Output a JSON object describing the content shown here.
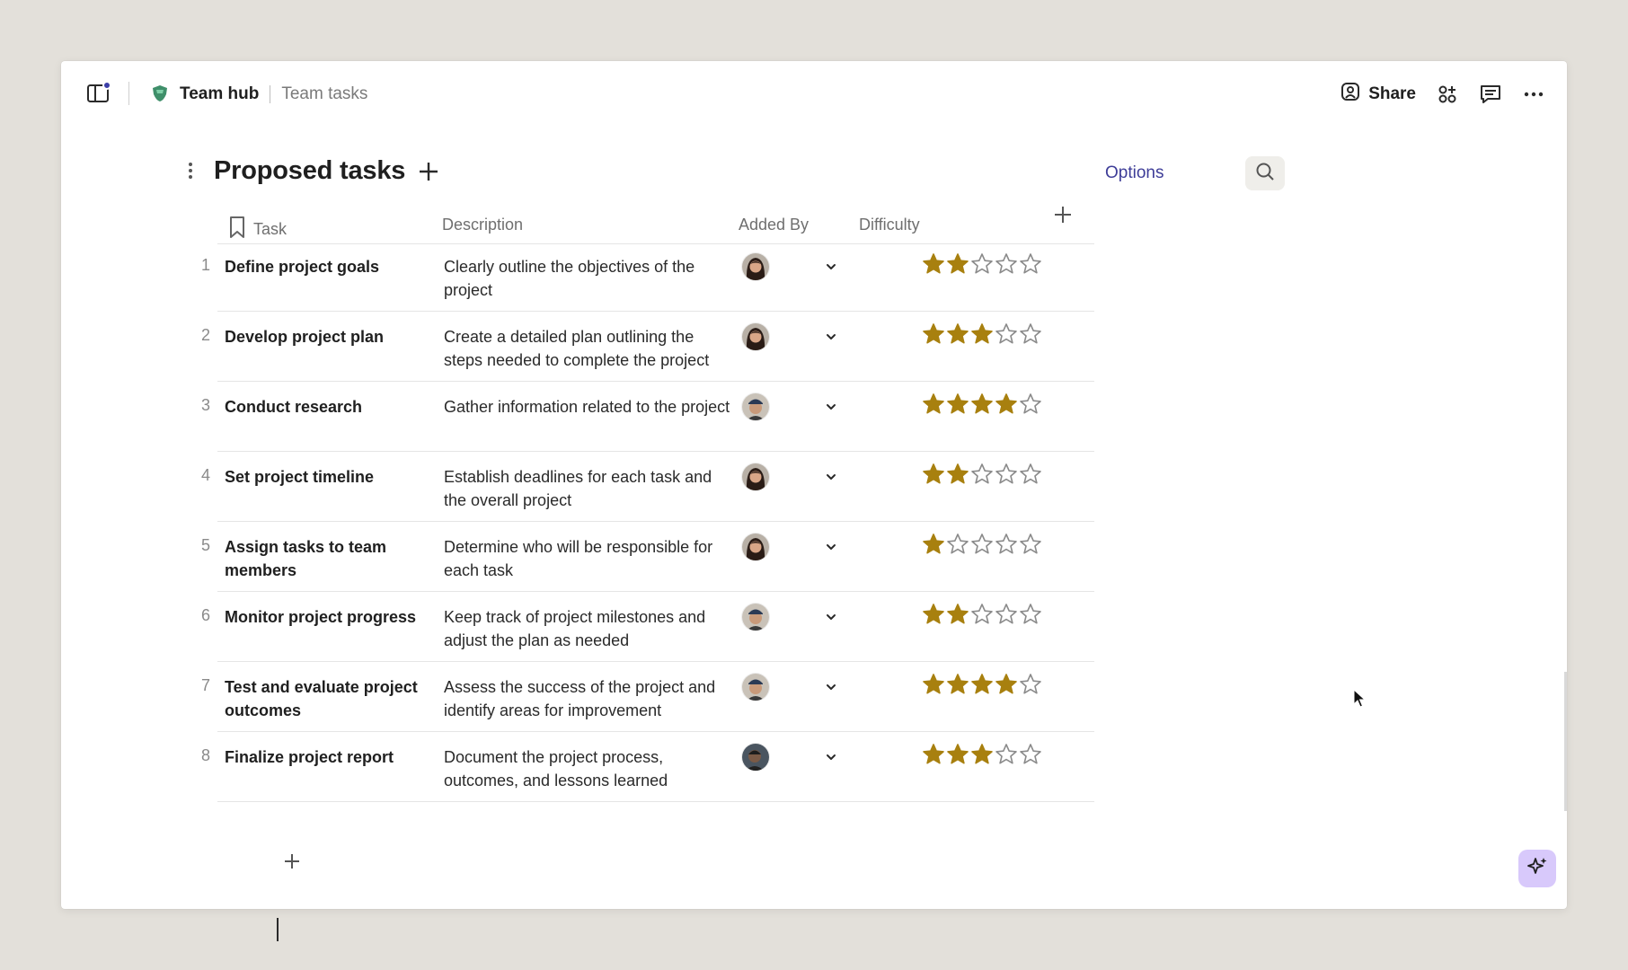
{
  "header": {
    "doc_title": "Team hub",
    "page_title": "Team tasks",
    "share_label": "Share"
  },
  "table": {
    "title": "Proposed tasks",
    "options_label": "Options",
    "columns": {
      "task": "Task",
      "description": "Description",
      "added_by": "Added By",
      "difficulty": "Difficulty"
    },
    "rows": [
      {
        "num": "1",
        "task": "Define project goals",
        "description": "Clearly outline the objectives of the project",
        "avatar": "woman-dark-hair",
        "difficulty": 2
      },
      {
        "num": "2",
        "task": "Develop project plan",
        "description": "Create a detailed plan outlining the steps needed to complete the project",
        "avatar": "woman-dark-hair",
        "difficulty": 3
      },
      {
        "num": "3",
        "task": "Conduct research",
        "description": "Gather information related to the project",
        "avatar": "man-cap",
        "difficulty": 4
      },
      {
        "num": "4",
        "task": "Set project timeline",
        "description": "Establish deadlines for each task and the overall project",
        "avatar": "woman-dark-hair",
        "difficulty": 2
      },
      {
        "num": "5",
        "task": "Assign tasks to team members",
        "description": "Determine who will be responsible for each task",
        "avatar": "woman-dark-hair",
        "difficulty": 1
      },
      {
        "num": "6",
        "task": "Monitor project progress",
        "description": "Keep track of project milestones and adjust the plan as needed",
        "avatar": "man-cap",
        "difficulty": 2
      },
      {
        "num": "7",
        "task": "Test and evaluate project outcomes",
        "description": "Assess the success of the project and identify areas for improvement",
        "avatar": "man-cap",
        "difficulty": 4
      },
      {
        "num": "8",
        "task": "Finalize project report",
        "description": "Document the project process, outcomes, and lessons learned",
        "avatar": "man-dark",
        "difficulty": 3
      }
    ],
    "difficulty_max": 5
  },
  "colors": {
    "star_filled": "#a8800f",
    "star_empty": "#8a8a8a",
    "accent": "#3e3d98",
    "ai_button": "#d8c9fb"
  },
  "icons": {
    "sidebar_toggle": "sidebar-toggle-icon",
    "doc": "doc-logo-icon",
    "share": "person-icon",
    "apps": "apps-icon",
    "comment": "comment-icon",
    "more": "more-horizontal-icon",
    "search": "search-icon",
    "add": "plus-icon",
    "bookmark": "bookmark-icon",
    "chevron": "chevron-down-icon",
    "ai": "sparkle-icon"
  }
}
